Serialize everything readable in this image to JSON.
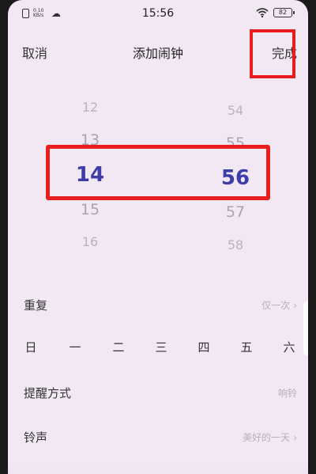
{
  "status_bar": {
    "time": "15:56",
    "net_speed": "0.10 KB/s",
    "battery": "82"
  },
  "header": {
    "cancel_label": "取消",
    "title": "添加闹钟",
    "done_label": "完成"
  },
  "picker": {
    "hours": [
      "12",
      "13",
      "14",
      "15",
      "16"
    ],
    "minutes": [
      "54",
      "55",
      "56",
      "57",
      "58"
    ],
    "selected_hour": "14",
    "selected_minute": "56"
  },
  "settings": {
    "repeat_label": "重复",
    "repeat_value": "仅一次",
    "weekdays": [
      "日",
      "一",
      "二",
      "三",
      "四",
      "五",
      "六"
    ],
    "reminder_label": "提醒方式",
    "reminder_value": "响铃",
    "ringtone_label": "铃声",
    "ringtone_value": "美好的一天"
  },
  "colors": {
    "accent": "#3e3ca8",
    "annotation": "#e81d1d",
    "background": "#f1e8f3"
  },
  "icons": [
    "sim-icon",
    "cloud-icon",
    "wifi-icon",
    "battery-icon",
    "chevron-right-icon"
  ]
}
